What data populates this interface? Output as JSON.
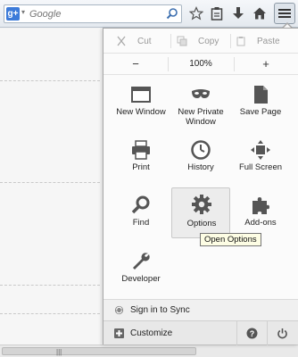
{
  "search": {
    "placeholder": "Google",
    "engine_label": "g+"
  },
  "menu": {
    "edit": {
      "cut": "Cut",
      "copy": "Copy",
      "paste": "Paste"
    },
    "zoom": {
      "out": "−",
      "level": "100%",
      "in": "+"
    },
    "items": [
      {
        "label": "New Window",
        "icon": "window-icon"
      },
      {
        "label": "New Private Window",
        "icon": "mask-icon"
      },
      {
        "label": "Save Page",
        "icon": "page-icon"
      },
      {
        "label": "Print",
        "icon": "printer-icon"
      },
      {
        "label": "History",
        "icon": "clock-icon"
      },
      {
        "label": "Full Screen",
        "icon": "fullscreen-icon"
      },
      {
        "label": "Find",
        "icon": "magnifier-icon"
      },
      {
        "label": "Options",
        "icon": "gear-icon"
      },
      {
        "label": "Add-ons",
        "icon": "puzzle-icon"
      },
      {
        "label": "Developer",
        "icon": "wrench-icon"
      }
    ],
    "tooltip": "Open Options",
    "sync": "Sign in to Sync",
    "customize": "Customize"
  },
  "colors": {
    "accent": "#3d7bd9",
    "tooltip_bg": "#fdfde4"
  }
}
